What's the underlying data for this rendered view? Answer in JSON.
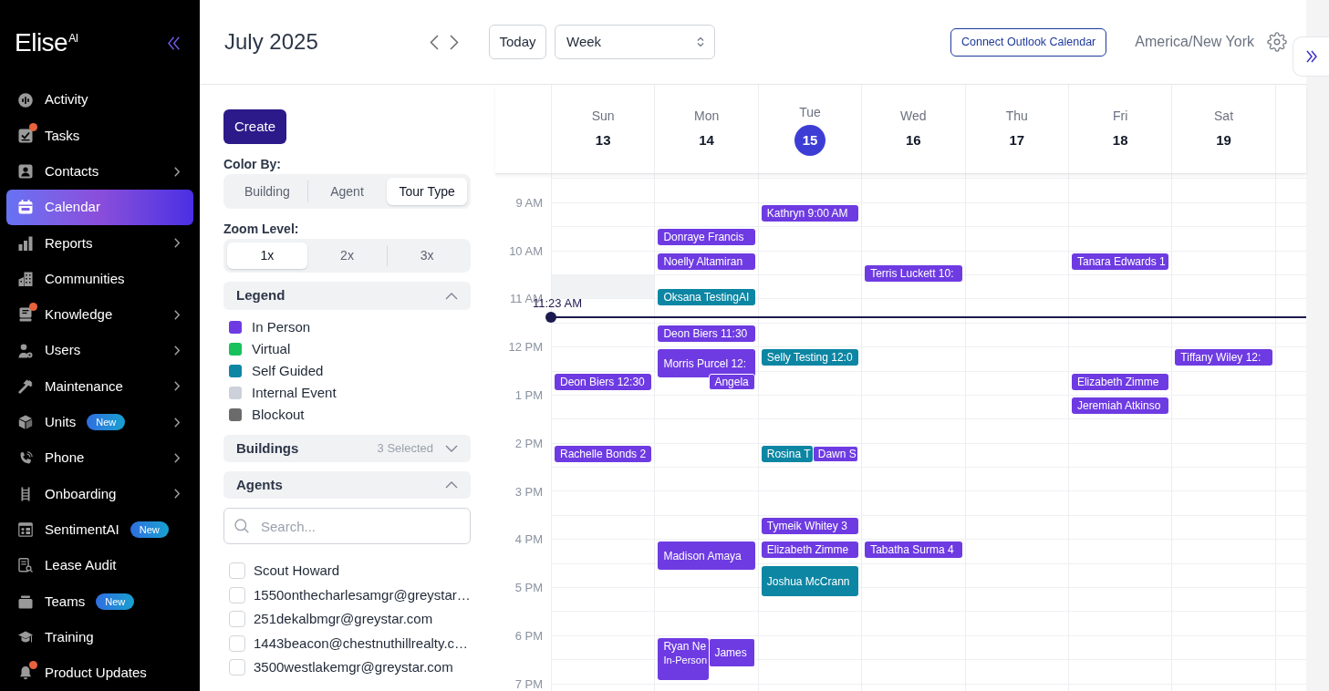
{
  "sidebar": {
    "logo": "Elise$^{AI}$",
    "items": [
      {
        "label": "Activity",
        "selected": false,
        "submenu": false,
        "notification": false
      },
      {
        "label": "Tasks",
        "selected": false,
        "submenu": false,
        "notification": true
      },
      {
        "label": "Contacts",
        "selected": false,
        "submenu": true,
        "notification": false
      },
      {
        "label": "Calendar",
        "selected": true,
        "submenu": false,
        "notification": false
      },
      {
        "label": "Reports",
        "selected": false,
        "submenu": true,
        "notification": false
      },
      {
        "label": "Communities",
        "selected": false,
        "submenu": false,
        "notification": false
      },
      {
        "label": "Knowledge",
        "selected": false,
        "submenu": true,
        "notification": true
      },
      {
        "label": "Users",
        "selected": false,
        "submenu": true,
        "notification": false
      },
      {
        "label": "Maintenance",
        "selected": false,
        "submenu": true,
        "notification": false
      },
      {
        "label": "Units",
        "selected": false,
        "submenu": true,
        "notification": false,
        "badge": "New"
      },
      {
        "label": "Phone",
        "selected": false,
        "submenu": true,
        "notification": false
      },
      {
        "label": "Onboarding",
        "selected": false,
        "submenu": true,
        "notification": false
      },
      {
        "label": "SentimentAI",
        "selected": false,
        "submenu": false,
        "notification": false,
        "badge": "New"
      },
      {
        "label": "Lease Audit",
        "selected": false,
        "submenu": false,
        "notification": false
      },
      {
        "label": "Teams",
        "selected": false,
        "submenu": false,
        "notification": false,
        "badge": "New"
      },
      {
        "label": "Training",
        "selected": false,
        "submenu": false,
        "notification": false
      },
      {
        "label": "Product Updates",
        "selected": false,
        "submenu": false,
        "notification": true
      }
    ]
  },
  "header": {
    "title": "July 2025",
    "today_button": "Today",
    "view_select": {
      "value": "Week"
    },
    "connect_button": "Connect Outlook Calendar",
    "timezone": "America/New York"
  },
  "filters": {
    "create_button": "Create",
    "color_by": {
      "label": "Color By:",
      "options": [
        {
          "label": "Building",
          "selected": false
        },
        {
          "label": "Agent",
          "selected": false
        },
        {
          "label": "Tour Type",
          "selected": true
        }
      ]
    },
    "zoom_level": {
      "label": "Zoom Level:",
      "options": [
        {
          "label": "1x",
          "selected": true
        },
        {
          "label": "2x",
          "selected": false
        },
        {
          "label": "3x",
          "selected": false
        }
      ]
    },
    "legend": {
      "title": "Legend",
      "expanded": true,
      "items": [
        {
          "label": "In Person",
          "color": "#6e3be2"
        },
        {
          "label": "Virtual",
          "color": "#17c15c"
        },
        {
          "label": "Self Guided",
          "color": "#0c86a3"
        },
        {
          "label": "Internal Event",
          "color": "#cdd1d9"
        },
        {
          "label": "Blockout",
          "color": "#6b6b6b"
        }
      ]
    },
    "buildings": {
      "title": "Buildings",
      "summary": "3 Selected",
      "expanded": false
    },
    "agents": {
      "title": "Agents",
      "expanded": true,
      "search": {
        "placeholder": "Search..."
      },
      "items": [
        {
          "label": "Scout Howard",
          "checked": false
        },
        {
          "label": "1550onthecharlesamgr@greystar…",
          "checked": false
        },
        {
          "label": "251dekalbmgr@greystar.com",
          "checked": false
        },
        {
          "label": "1443beacon@chestnuthillrealty.c…",
          "checked": false
        },
        {
          "label": "3500westlakemgr@greystar.com",
          "checked": false
        }
      ]
    }
  },
  "calendar": {
    "time_labels": [
      "9 AM",
      "10 AM",
      "11 AM",
      "12 PM",
      "1 PM",
      "2 PM",
      "3 PM",
      "4 PM",
      "5 PM",
      "6 PM",
      "7 PM"
    ],
    "current_time": "11:23 AM",
    "days": [
      {
        "name": "Sun",
        "date": "13",
        "today": false,
        "events": [
          {
            "kind": "blocked",
            "color": "#f1f2f4"
          },
          {
            "kind": "tour",
            "title": "Deon Biers 12:30",
            "color": "#6e3be2"
          },
          {
            "kind": "tour",
            "title": "Rachelle Bonds 2",
            "color": "#6e3be2"
          }
        ]
      },
      {
        "name": "Mon",
        "date": "14",
        "today": false,
        "events": [
          {
            "kind": "tour",
            "title": "Donraye Francis",
            "color": "#6e3be2"
          },
          {
            "kind": "tour",
            "title": "Noelly Altamiran",
            "color": "#6e3be2"
          },
          {
            "kind": "tour",
            "title": "Oksana TestingAI",
            "color": "#0c86a3"
          },
          {
            "kind": "tour",
            "title": "Deon Biers 11:30",
            "color": "#6e3be2"
          },
          {
            "kind": "tour",
            "title": "Morris Purcel 12:",
            "color": "#6e3be2"
          },
          {
            "kind": "tour",
            "title": "Angela",
            "color": "#6e3be2"
          },
          {
            "kind": "tour",
            "title": "Madison Amaya",
            "color": "#6e3be2"
          },
          {
            "kind": "tour",
            "title": "Ryan Ne",
            "subtitle": "In-Person",
            "color": "#6e3be2"
          },
          {
            "kind": "tour",
            "title": "James",
            "color": "#6e3be2"
          }
        ]
      },
      {
        "name": "Tue",
        "date": "15",
        "today": true,
        "events": [
          {
            "kind": "tour",
            "title": "Kathryn 9:00 AM",
            "color": "#6e3be2"
          },
          {
            "kind": "tour",
            "title": "Selly Testing 12:0",
            "color": "#0c86a3"
          },
          {
            "kind": "tour",
            "title": "Rosina T",
            "color": "#0c86a3"
          },
          {
            "kind": "tour",
            "title": "Dawn S",
            "color": "#6e3be2"
          },
          {
            "kind": "tour",
            "title": "Tymeik Whitey 3",
            "color": "#6e3be2"
          },
          {
            "kind": "tour",
            "title": "Elizabeth Zimme",
            "color": "#6e3be2"
          },
          {
            "kind": "tour",
            "title": "Joshua McCrann",
            "color": "#0c86a3"
          }
        ]
      },
      {
        "name": "Wed",
        "date": "16",
        "today": false,
        "events": [
          {
            "kind": "tour",
            "title": "Terris Luckett 10:",
            "color": "#6e3be2"
          },
          {
            "kind": "tour",
            "title": "Tabatha Surma 4",
            "color": "#6e3be2"
          }
        ]
      },
      {
        "name": "Thu",
        "date": "17",
        "today": false
      },
      {
        "name": "Fri",
        "date": "18",
        "today": false,
        "events": [
          {
            "kind": "tour",
            "title": "Tanara Edwards 1",
            "color": "#6e3be2"
          },
          {
            "kind": "tour",
            "title": "Elizabeth Zimme",
            "color": "#6e3be2"
          },
          {
            "kind": "tour",
            "title": "Jeremiah Atkinso",
            "color": "#6e3be2"
          }
        ]
      },
      {
        "name": "Sat",
        "date": "19",
        "today": false,
        "events": [
          {
            "kind": "tour",
            "title": "Tiffany Wiley 12:",
            "color": "#6e3be2"
          }
        ]
      }
    ]
  }
}
